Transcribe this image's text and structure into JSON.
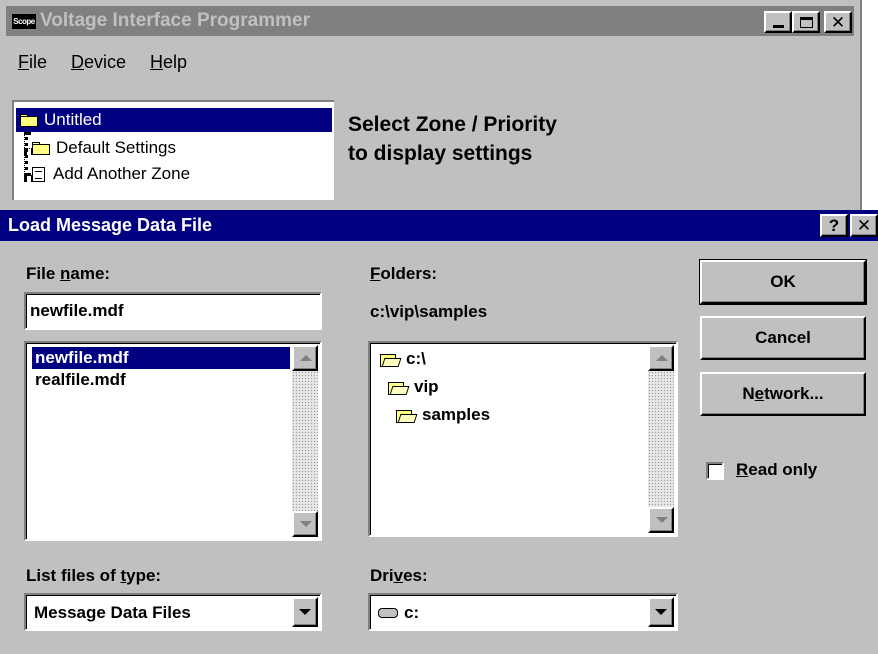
{
  "main_window": {
    "title": "Voltage Interface Programmer",
    "app_icon_text": "Scope",
    "menu": [
      {
        "label": "File",
        "hotkey": "F",
        "rest": "ile"
      },
      {
        "label": "Device",
        "hotkey": "D",
        "rest": "evice"
      },
      {
        "label": "Help",
        "hotkey": "H",
        "rest": "elp"
      }
    ],
    "tree": {
      "root": "Untitled",
      "children": [
        "Default Settings",
        "Add Another Zone"
      ]
    },
    "hint_line1": "Select Zone / Priority",
    "hint_line2": "to display settings"
  },
  "dialog": {
    "title": "Load Message Data File",
    "help_glyph": "?",
    "close_glyph": "✕",
    "file_name_label": {
      "pre": "File ",
      "hot": "n",
      "post": "ame:"
    },
    "file_name_value": "newfile.mdf",
    "files": [
      "newfile.mdf",
      "realfile.mdf"
    ],
    "folders_label": {
      "pre": "",
      "hot": "F",
      "post": "olders:"
    },
    "current_path": "c:\\vip\\samples",
    "folders": [
      "c:\\",
      "vip",
      "samples"
    ],
    "buttons": {
      "ok": "OK",
      "cancel": "Cancel",
      "network": {
        "pre": "N",
        "hot": "e",
        "post": "twork..."
      }
    },
    "read_only": {
      "pre": "",
      "hot": "R",
      "post": "ead only",
      "checked": false
    },
    "file_type_label": {
      "pre": "List files of ",
      "hot": "t",
      "post": "ype:"
    },
    "file_type_value": "Message Data Files",
    "drives_label": {
      "pre": "Dri",
      "hot": "v",
      "post": "es:"
    },
    "drive_value": "c:"
  },
  "colors": {
    "face": "#c0c0c0",
    "active_title": "#000080",
    "inactive_title": "#808080",
    "selection": "#000080",
    "folder_yellow": "#ffff80"
  }
}
